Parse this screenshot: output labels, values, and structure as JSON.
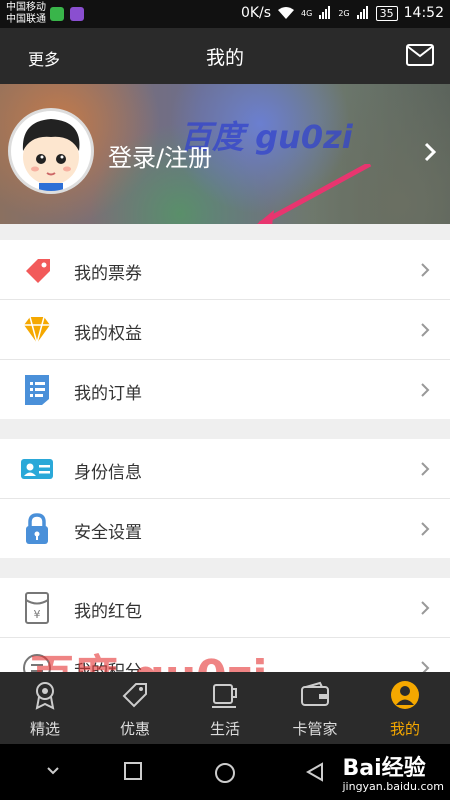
{
  "status_bar": {
    "carriers": [
      "中国移动",
      "中国联通"
    ],
    "speed": "0K/s",
    "net1": "4G",
    "net2": "2G",
    "battery": "35",
    "time": "14:52"
  },
  "header": {
    "left": "更多",
    "title": "我的"
  },
  "banner": {
    "login": "登录/注册",
    "watermark": "百度 gu0zi"
  },
  "groups": [
    [
      {
        "label": "我的票券",
        "icon": "ticket-icon"
      },
      {
        "label": "我的权益",
        "icon": "diamond-icon"
      },
      {
        "label": "我的订单",
        "icon": "order-list-icon"
      }
    ],
    [
      {
        "label": "身份信息",
        "icon": "id-card-icon"
      },
      {
        "label": "安全设置",
        "icon": "lock-icon"
      }
    ],
    [
      {
        "label": "我的红包",
        "icon": "red-envelope-icon"
      },
      {
        "label": "我的积分",
        "icon": "points-icon"
      }
    ]
  ],
  "content_watermark": "百度 gu0zi",
  "tabs": [
    {
      "label": "精选",
      "icon": "medal-icon"
    },
    {
      "label": "优惠",
      "icon": "tag-icon"
    },
    {
      "label": "生活",
      "icon": "cup-icon"
    },
    {
      "label": "卡管家",
      "icon": "wallet-icon"
    },
    {
      "label": "我的",
      "icon": "profile-icon",
      "active": true
    }
  ],
  "baidu": {
    "logo": "Bai经验",
    "url": "jingyan.baidu.com"
  },
  "colors": {
    "accent": "#f5a800",
    "header_bg": "#2a2a2a",
    "tabbar_bg": "#2b2b2b"
  }
}
